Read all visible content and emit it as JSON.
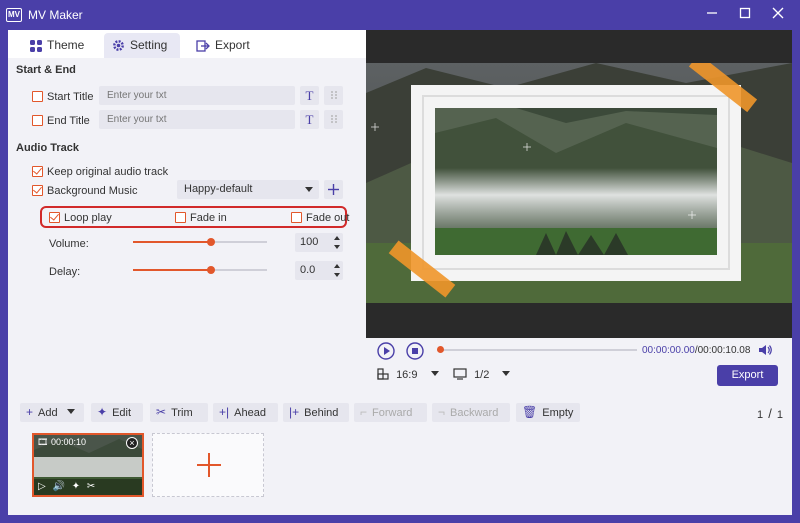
{
  "window": {
    "title": "MV Maker",
    "logo_text": "MV"
  },
  "tabs": [
    {
      "label": "Theme",
      "icon": "grid-icon"
    },
    {
      "label": "Setting",
      "icon": "gear-icon"
    },
    {
      "label": "Export",
      "icon": "export-icon"
    }
  ],
  "start_end": {
    "heading": "Start & End",
    "start_title": {
      "label": "Start Title",
      "placeholder": "Enter your txt",
      "checked": false
    },
    "end_title": {
      "label": "End Title",
      "placeholder": "Enter your txt",
      "checked": false
    },
    "text_button": "T"
  },
  "audio": {
    "heading": "Audio Track",
    "keep_original": {
      "label": "Keep original audio track",
      "checked": true
    },
    "background_music": {
      "label": "Background Music",
      "checked": true,
      "selected": "Happy-default"
    },
    "loop_play": {
      "label": "Loop play",
      "checked": true
    },
    "fade_in": {
      "label": "Fade in",
      "checked": false
    },
    "fade_out": {
      "label": "Fade out",
      "checked": false
    },
    "volume": {
      "label": "Volume:",
      "value": "100",
      "level": 0.58
    },
    "delay": {
      "label": "Delay:",
      "value": "0.0",
      "level": 0.58
    }
  },
  "player": {
    "time": "00:00:00.00/00:00:10.08",
    "current": "00:00:00.00",
    "total": "/00:00:10.08",
    "aspect": "16:9",
    "page": "1/2",
    "export_label": "Export"
  },
  "toolbar": {
    "add": "Add",
    "edit": "Edit",
    "trim": "Trim",
    "ahead": "Ahead",
    "behind": "Behind",
    "forward": "Forward",
    "backward": "Backward",
    "empty": "Empty"
  },
  "pager": {
    "current": "1",
    "total": "1"
  },
  "clip": {
    "duration": "00:00:10"
  },
  "colors": {
    "accent": "#e2572b",
    "brand": "#4a3fa8"
  }
}
